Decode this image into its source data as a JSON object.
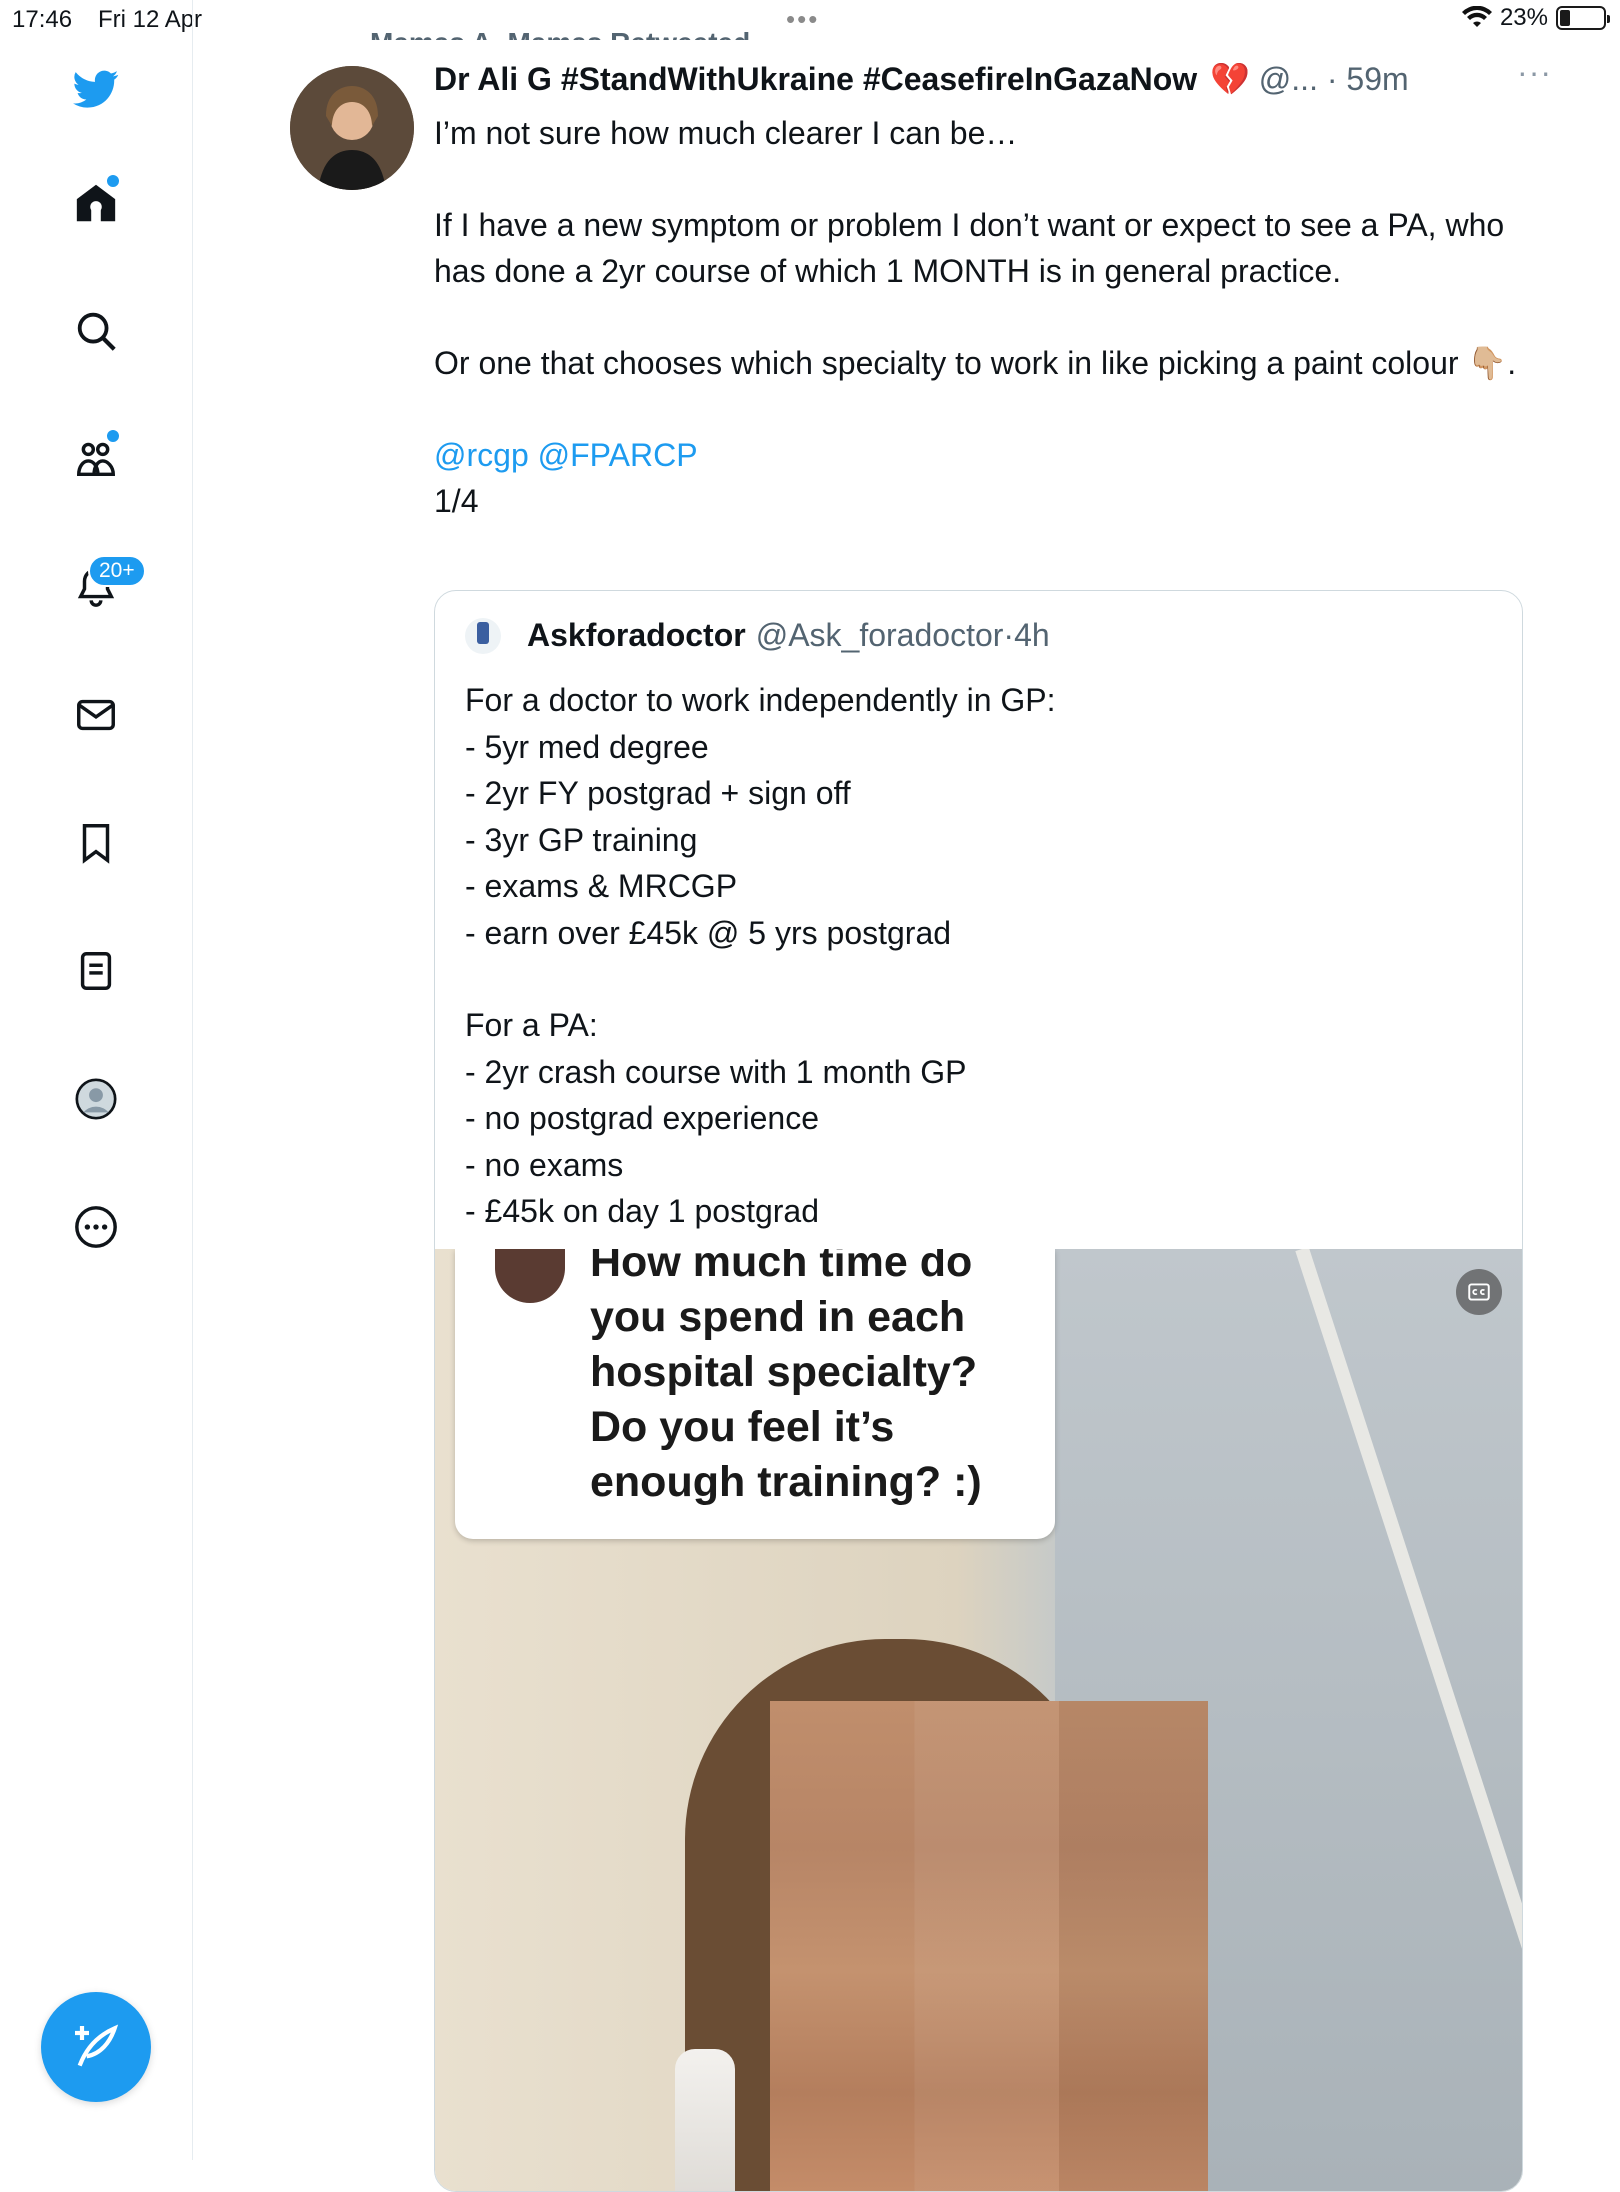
{
  "status_bar": {
    "time": "17:46",
    "date": "Fri 12 Apr",
    "battery_percent": "23%",
    "battery_level": 0.23
  },
  "sidebar": {
    "items": [
      {
        "name": "twitter-logo-icon"
      },
      {
        "name": "home-icon",
        "has_dot": true
      },
      {
        "name": "search-icon"
      },
      {
        "name": "communities-icon",
        "has_dot": true
      },
      {
        "name": "notifications-icon",
        "badge": "20+"
      },
      {
        "name": "messages-icon"
      },
      {
        "name": "bookmarks-icon"
      },
      {
        "name": "lists-icon"
      },
      {
        "name": "profile-icon"
      },
      {
        "name": "more-icon"
      }
    ],
    "compose_icon": "compose-feather-icon",
    "accent": "#1d9bf0"
  },
  "retweet_banner": "Mamas A. Mamas Retweeted",
  "tweet": {
    "author_name": "Dr Ali G #StandWithUkraine #CeasefireInGazaNow",
    "author_emoji": "💔",
    "handle": "@...",
    "separator": "·",
    "time": "59m",
    "more": "···",
    "lines": [
      "I’m not sure how much clearer I can be…",
      "If I have a new symptom or problem I don’t want or expect to see a PA, who has done a 2yr course of which 1 MONTH is in general practice.",
      "Or one that chooses which specialty to work in like picking a paint colour 👇🏼."
    ],
    "mentions": "@rcgp @FPARCP",
    "thread_count": "1/4"
  },
  "quote": {
    "name": "Askforadoctor",
    "handle": "@Ask_foradoctor",
    "separator": "·",
    "time": "4h",
    "intro": "For a doctor to work independently in GP:",
    "doctor_list": [
      "- 5yr med degree",
      "- 2yr FY postgrad + sign off",
      "- 3yr GP training",
      "- exams & MRCGP",
      "- earn over £45k @ 5 yrs postgrad"
    ],
    "pa_intro": "For a PA:",
    "pa_list": [
      "- 2yr crash course with 1 month GP",
      "- no postgrad experience",
      "- no exams",
      "- £45k on day 1 postgrad"
    ],
    "media_question": "How much time do you spend in each hospital specialty? Do you feel it’s enough training? :)",
    "media_cc_icon": "closed-captions-icon"
  }
}
